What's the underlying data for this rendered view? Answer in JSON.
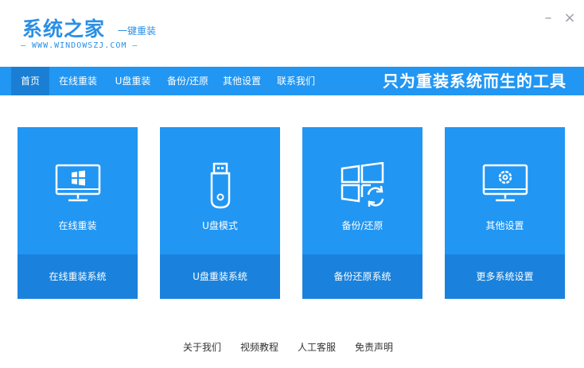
{
  "header": {
    "logo_title": "系统之家",
    "logo_subtitle": "一键重装",
    "logo_url": "— WWW.WINDOWSZJ.COM —",
    "minimize_label": "–",
    "close_label": "×"
  },
  "nav": {
    "items": [
      {
        "label": "首页",
        "active": true
      },
      {
        "label": "在线重装"
      },
      {
        "label": "U盘重装"
      },
      {
        "label": "备份/还原"
      },
      {
        "label": "其他设置"
      },
      {
        "label": "联系我们"
      }
    ],
    "slogan": "只为重装系统而生的工具"
  },
  "cards": [
    {
      "label": "在线重装",
      "action": "在线重装系统",
      "icon": "monitor-windows-icon"
    },
    {
      "label": "U盘模式",
      "action": "U盘重装系统",
      "icon": "usb-drive-icon"
    },
    {
      "label": "备份/还原",
      "action": "备份还原系统",
      "icon": "windows-restore-icon"
    },
    {
      "label": "其他设置",
      "action": "更多系统设置",
      "icon": "monitor-gear-icon"
    }
  ],
  "footer": {
    "links": [
      "关于我们",
      "视频教程",
      "人工客服",
      "免责声明"
    ]
  },
  "colors": {
    "brand": "#2196f3",
    "brand_dark": "#1a82dc",
    "logo": "#2a8fe6"
  }
}
